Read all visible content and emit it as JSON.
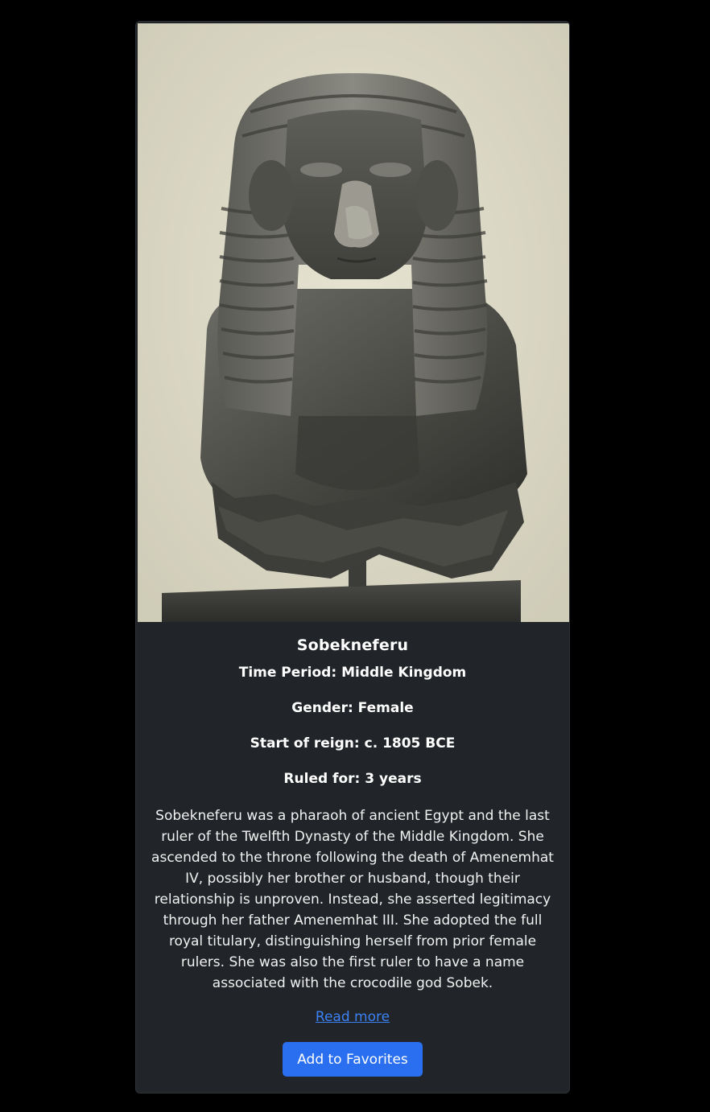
{
  "card": {
    "image_alt": "Bust of Sobekneferu",
    "title": "Sobekneferu",
    "time_period": "Time Period: Middle Kingdom",
    "gender": "Gender: Female",
    "start_of_reign": "Start of reign: c. 1805 BCE",
    "ruled_for": "Ruled for: 3 years",
    "description": "Sobekneferu was a pharaoh of ancient Egypt and the last ruler of the Twelfth Dynasty of the Middle Kingdom. She ascended to the throne following the death of Amenemhat IV, possibly her brother or husband, though their relationship is unproven. Instead, she asserted legitimacy through her father Amenemhat III. She adopted the full royal titulary, distinguishing herself from prior female rulers. She was also the first ruler to have a name associated with the crocodile god Sobek.",
    "read_more_label": "Read more",
    "favorite_button_label": "Add to Favorites"
  },
  "colors": {
    "page_background": "#000000",
    "card_background": "#212529",
    "link": "#3b82f6",
    "button": "#2a6ff0",
    "photo_background": "#dcd9c5"
  }
}
